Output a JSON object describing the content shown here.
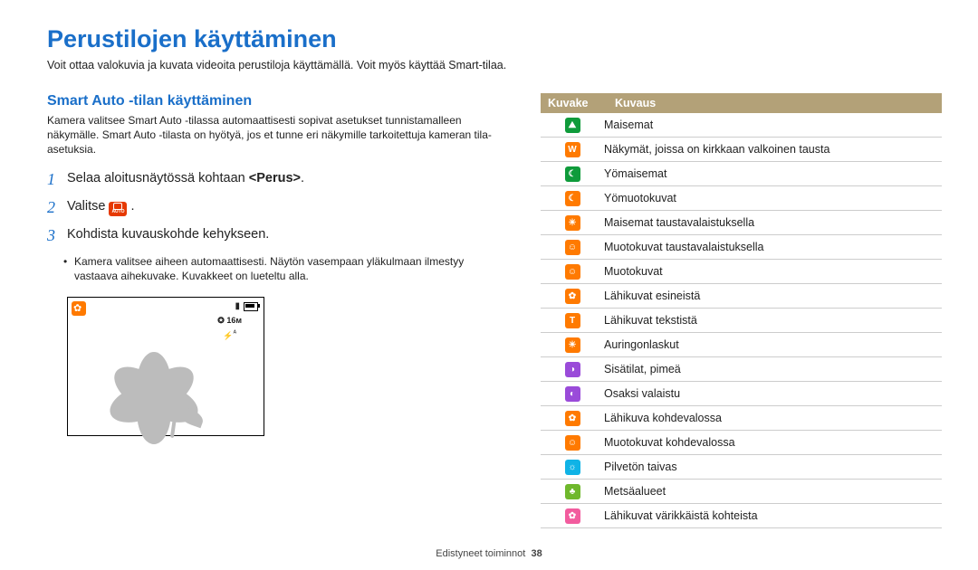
{
  "page": {
    "title": "Perustilojen käyttäminen",
    "intro": "Voit ottaa valokuvia ja kuvata videoita perustiloja käyttämällä. Voit myös käyttää Smart-tilaa."
  },
  "left": {
    "heading": "Smart Auto -tilan käyttäminen",
    "subintro": "Kamera valitsee Smart Auto -tilassa automaattisesti sopivat asetukset tunnistamalleen näkymälle. Smart Auto -tilasta on hyötyä, jos et tunne eri näkymille tarkoitettuja kameran tila-asetuksia.",
    "steps": {
      "s1_pre": "Selaa aloitusnäytössä kohtaan ",
      "s1_strong": "<Perus>",
      "s1_post": ".",
      "s2_pre": "Valitse ",
      "s2_post": " .",
      "s3": "Kohdista kuvauskohde kehykseen."
    },
    "bullet": "Kamera valitsee aiheen automaattisesti. Näytön vasempaan yläkulmaan ilmestyy vastaava aihekuvake. Kuvakkeet on lueteltu alla.",
    "preview": {
      "info_line2": "16м",
      "info_line3": "ᴬ"
    }
  },
  "table": {
    "col_icon": "Kuvake",
    "col_desc": "Kuvaus",
    "rows": [
      {
        "bg": "#0f9b3b",
        "glyph": "⛰",
        "desc": "Maisemat"
      },
      {
        "bg": "#ff7a00",
        "glyph": "W",
        "desc": "Näkymät, joissa on kirkkaan valkoinen tausta"
      },
      {
        "bg": "#0f9b3b",
        "glyph": "☾",
        "desc": "Yömaisemat"
      },
      {
        "bg": "#ff7a00",
        "glyph": "☾",
        "desc": "Yömuotokuvat"
      },
      {
        "bg": "#ff7a00",
        "glyph": "☀",
        "desc": "Maisemat taustavalaistuksella"
      },
      {
        "bg": "#ff7a00",
        "glyph": "☺",
        "desc": "Muotokuvat taustavalaistuksella"
      },
      {
        "bg": "#ff7a00",
        "glyph": "☺",
        "desc": "Muotokuvat"
      },
      {
        "bg": "#ff7a00",
        "glyph": "✿",
        "desc": "Lähikuvat esineistä"
      },
      {
        "bg": "#ff7a00",
        "glyph": "T",
        "desc": "Lähikuvat tekstistä"
      },
      {
        "bg": "#ff7a00",
        "glyph": "☀",
        "desc": "Auringonlaskut"
      },
      {
        "bg": "#9a4bd9",
        "glyph": "◑",
        "desc": "Sisätilat, pimeä"
      },
      {
        "bg": "#9a4bd9",
        "glyph": "◐",
        "desc": "Osaksi valaistu"
      },
      {
        "bg": "#ff7a00",
        "glyph": "✿",
        "desc": "Lähikuva kohdevalossa"
      },
      {
        "bg": "#ff7a00",
        "glyph": "☺",
        "desc": "Muotokuvat kohdevalossa"
      },
      {
        "bg": "#10b3e6",
        "glyph": "☼",
        "desc": "Pilvetön taivas"
      },
      {
        "bg": "#6fb82c",
        "glyph": "♣",
        "desc": "Metsäalueet"
      },
      {
        "bg": "#f25c9e",
        "glyph": "✿",
        "desc": "Lähikuvat värikkäistä kohteista"
      }
    ]
  },
  "footer": {
    "text": "Edistyneet toiminnot",
    "page": "38"
  }
}
